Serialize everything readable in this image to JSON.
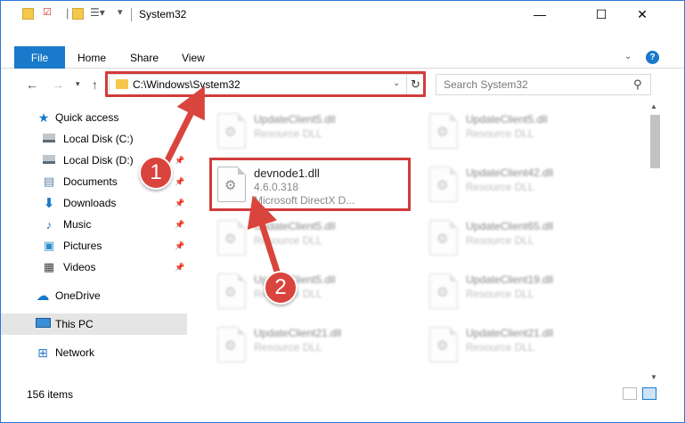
{
  "window": {
    "title": "System32",
    "controls": {
      "minimize": "—",
      "maximize": "☐",
      "close": "✕"
    }
  },
  "ribbon": {
    "file": "File",
    "tabs": [
      "Home",
      "Share",
      "View"
    ],
    "help": "?"
  },
  "address": {
    "path": "C:\\Windows\\System32",
    "search_placeholder": "Search System32"
  },
  "nav": {
    "quick_access": "Quick access",
    "items": [
      {
        "label": "Local Disk (C:)",
        "icon": "drive-icon",
        "pinned": false
      },
      {
        "label": "Local Disk (D:)",
        "icon": "drive-icon",
        "pinned": true
      },
      {
        "label": "Documents",
        "icon": "documents-icon",
        "pinned": true
      },
      {
        "label": "Downloads",
        "icon": "download-icon",
        "pinned": true
      },
      {
        "label": "Music",
        "icon": "music-icon",
        "pinned": true
      },
      {
        "label": "Pictures",
        "icon": "pictures-icon",
        "pinned": true
      },
      {
        "label": "Videos",
        "icon": "videos-icon",
        "pinned": true
      }
    ],
    "onedrive": "OneDrive",
    "this_pc": "This PC",
    "network": "Network"
  },
  "files": {
    "focused": {
      "name": "devnode1.dll",
      "version": "4.6.0.318",
      "description": "Microsoft DirectX D..."
    },
    "blurred_left": [
      {
        "name": "UpdateClient5.dll",
        "type": "Resource DLL"
      },
      {
        "name": "UpdateClient5.dll",
        "type": "Resource DLL"
      },
      {
        "name": "UpdateClient5.dll",
        "type": "Resource DLL"
      },
      {
        "name": "UpdateClient21.dll",
        "type": "Resource DLL"
      }
    ],
    "blurred_right": [
      {
        "name": "UpdateClient5.dll",
        "type": "Resource DLL"
      },
      {
        "name": "UpdateClient42.dll",
        "type": "Resource DLL"
      },
      {
        "name": "UpdateClient65.dll",
        "type": "Resource DLL"
      },
      {
        "name": "UpdateClient19.dll",
        "type": "Resource DLL"
      },
      {
        "name": "UpdateClient21.dll",
        "type": "Resource DLL"
      }
    ]
  },
  "status": {
    "items": "156 items"
  },
  "annotations": {
    "step1": "1",
    "step2": "2"
  },
  "colors": {
    "accent": "#1979ca",
    "highlight": "#d23b3b"
  }
}
